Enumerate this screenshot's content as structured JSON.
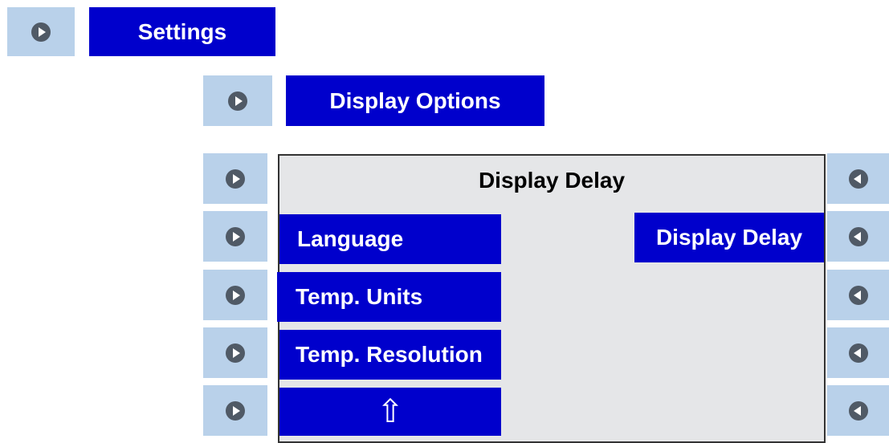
{
  "breadcrumb": {
    "level1_label": "Settings",
    "level2_label": "Display Options"
  },
  "panel": {
    "title": "Display Delay"
  },
  "menu": {
    "items": [
      {
        "label": "Language"
      },
      {
        "label": "Temp. Units"
      },
      {
        "label": "Temp. Resolution"
      },
      {
        "label": "⇧"
      }
    ]
  },
  "selected_value": {
    "label": "Display Delay"
  },
  "icons": {
    "left_buttons": "play-right-icon",
    "right_buttons": "play-left-icon",
    "home": "up-arrow-icon"
  },
  "colors": {
    "accent_blue": "#0000cc",
    "side_button": "#b9d1ea",
    "panel_bg": "#e5e6e8",
    "icon_fill": "#505a66"
  }
}
